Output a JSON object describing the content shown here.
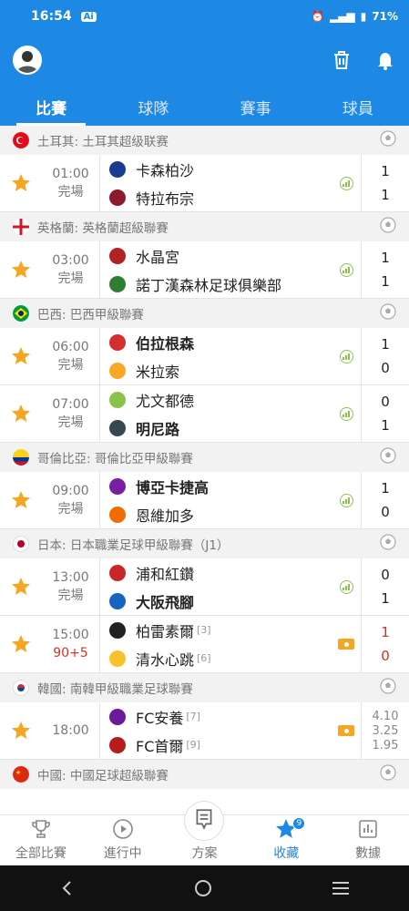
{
  "status_bar": {
    "time": "16:54",
    "ai_badge": "Ai",
    "battery": "71%"
  },
  "header": {
    "avatar_icon": "user-avatar",
    "actions": [
      "trash-icon",
      "bell-icon"
    ]
  },
  "tabs": [
    {
      "label": "比賽",
      "active": true
    },
    {
      "label": "球隊",
      "active": false
    },
    {
      "label": "賽事",
      "active": false
    },
    {
      "label": "球員",
      "active": false
    }
  ],
  "leagues": [
    {
      "name": "土耳其: 土耳其超级联赛",
      "flag": "turkey",
      "matches": [
        {
          "time": "01:00",
          "status": "完場",
          "home": "卡森柏沙",
          "away": "特拉布宗",
          "home_score": "1",
          "away_score": "1",
          "home_rank": "",
          "away_rank": "",
          "home_bold": false,
          "away_bold": false,
          "state": "finished"
        }
      ]
    },
    {
      "name": "英格蘭: 英格蘭超級聯賽",
      "flag": "england",
      "matches": [
        {
          "time": "03:00",
          "status": "完場",
          "home": "水晶宮",
          "away": "諾丁漢森林足球俱樂部",
          "home_score": "1",
          "away_score": "1",
          "home_rank": "",
          "away_rank": "",
          "home_bold": false,
          "away_bold": false,
          "state": "finished"
        }
      ]
    },
    {
      "name": "巴西: 巴西甲級聯賽",
      "flag": "brazil",
      "matches": [
        {
          "time": "06:00",
          "status": "完場",
          "home": "伯拉根森",
          "away": "米拉索",
          "home_score": "1",
          "away_score": "0",
          "home_rank": "",
          "away_rank": "",
          "home_bold": true,
          "away_bold": false,
          "state": "finished"
        },
        {
          "time": "07:00",
          "status": "完場",
          "home": "尤文都德",
          "away": "明尼路",
          "home_score": "0",
          "away_score": "1",
          "home_rank": "",
          "away_rank": "",
          "home_bold": false,
          "away_bold": true,
          "state": "finished"
        }
      ]
    },
    {
      "name": "哥倫比亞: 哥倫比亞甲級聯賽",
      "flag": "colombia",
      "matches": [
        {
          "time": "09:00",
          "status": "完場",
          "home": "博亞卡捷高",
          "away": "恩維加多",
          "home_score": "1",
          "away_score": "0",
          "home_rank": "",
          "away_rank": "",
          "home_bold": true,
          "away_bold": false,
          "state": "finished"
        }
      ]
    },
    {
      "name": "日本: 日本職業足球甲級聯賽（J1）",
      "flag": "japan",
      "matches": [
        {
          "time": "13:00",
          "status": "完場",
          "home": "浦和紅鑽",
          "away": "大阪飛腳",
          "home_score": "0",
          "away_score": "1",
          "home_rank": "",
          "away_rank": "",
          "home_bold": false,
          "away_bold": true,
          "state": "finished"
        },
        {
          "time": "15:00",
          "status": "90+5",
          "home": "柏雷素爾",
          "away": "清水心跳",
          "home_score": "1",
          "away_score": "0",
          "home_rank": "[3]",
          "away_rank": "[6]",
          "home_bold": false,
          "away_bold": false,
          "state": "live"
        }
      ]
    },
    {
      "name": "韓國: 南韓甲級職業足球聯賽",
      "flag": "korea",
      "matches": [
        {
          "time": "18:00",
          "status": "",
          "home": "FC安養",
          "away": "FC首爾",
          "home_score": "",
          "away_score": "",
          "home_rank": "[7]",
          "away_rank": "[9]",
          "home_bold": false,
          "away_bold": false,
          "state": "upcoming",
          "odds": [
            "4.10",
            "3.25",
            "1.95"
          ]
        }
      ]
    },
    {
      "name": "中國: 中國足球超級聯賽",
      "flag": "china",
      "matches": []
    }
  ],
  "bottom_nav": [
    {
      "label": "全部比賽",
      "icon": "trophy-icon",
      "active": false
    },
    {
      "label": "進行中",
      "icon": "play-icon",
      "active": false
    },
    {
      "label": "方案",
      "icon": "plan-icon",
      "active": false
    },
    {
      "label": "收藏",
      "icon": "star-icon",
      "active": true,
      "badge": "9"
    },
    {
      "label": "數據",
      "icon": "chart-icon",
      "active": false
    }
  ],
  "colors": {
    "primary": "#1e88e5",
    "star": "#f5a623",
    "live": "#d93025",
    "stats": "#8bc34a"
  }
}
